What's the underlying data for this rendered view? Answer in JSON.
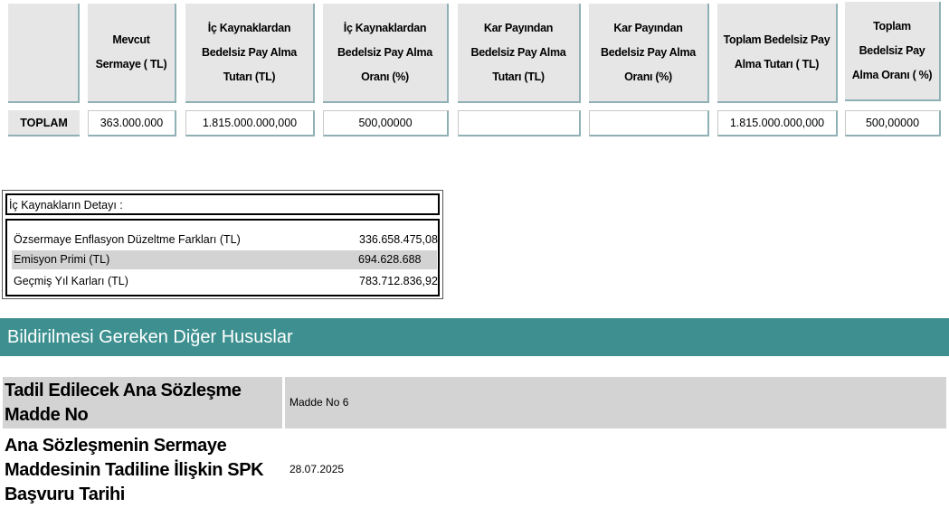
{
  "table": {
    "headers": [
      "",
      "Mevcut Sermaye ( TL)",
      "İç Kaynaklardan Bedelsiz Pay Alma Tutarı (TL)",
      "İç Kaynaklardan Bedelsiz Pay Alma Oranı (%)",
      "Kar Payından Bedelsiz Pay Alma Tutarı (TL)",
      "Kar Payından Bedelsiz Pay Alma Oranı (%)",
      "Toplam Bedelsiz Pay Alma Tutarı ( TL)",
      "Toplam Bedelsiz Pay Alma Oranı ( %)"
    ],
    "row": {
      "label": "TOPLAM",
      "values": [
        "363.000.000",
        "1.815.000.000,000",
        "500,00000",
        "",
        "",
        "1.815.000.000,000",
        "500,00000"
      ]
    }
  },
  "detail": {
    "title": "İç Kaynakların Detayı :",
    "rows": [
      {
        "name": "Özsermaye Enflasyon Düzeltme Farkları (TL)",
        "value": "336.658.475,08"
      },
      {
        "name": "Emisyon Primi (TL)",
        "value": "694.628.688"
      },
      {
        "name": "Geçmiş Yıl Karları (TL)",
        "value": "783.712.836,92"
      }
    ]
  },
  "section": {
    "title": "Bildirilmesi Gereken Diğer Hususlar",
    "color": "#3e9090"
  },
  "info": [
    {
      "label": "Tadil Edilecek Ana Sözleşme Madde No",
      "value": "Madde No 6"
    },
    {
      "label": "Ana Sözleşmenin Sermaye Maddesinin Tadiline İlişkin SPK Başvuru Tarihi",
      "value": "28.07.2025"
    }
  ]
}
